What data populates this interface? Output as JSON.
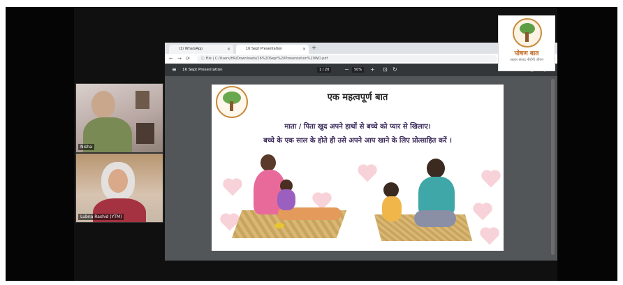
{
  "browser": {
    "tabs": [
      {
        "label": "(1) WhatsApp",
        "close": "×"
      },
      {
        "label": "16 Sept Presentation",
        "close": "×"
      }
    ],
    "new_tab": "+",
    "nav": {
      "back": "←",
      "forward": "→",
      "reload": "⟳"
    },
    "url": "ⓘ File | C:/Users/HR/Downloads/16%20Sept%20Presentation%20WO.pdf"
  },
  "pdf_viewer": {
    "menu": "≡",
    "title": "16 Sept Presentation",
    "pages": "1 / 20",
    "zoom": "50%",
    "minus": "−",
    "plus": "+",
    "fit": "⊡",
    "rotate": "↻",
    "download": "⬇",
    "print": "🖶",
    "more": "⋮"
  },
  "slide": {
    "title": "एक महत्वपूर्ण बात",
    "line1": "माता / पिता खुद अपने हाथों से बच्चे को प्यार से खिलाए।",
    "line2": "बच्चे के एक साल के होते ही उसे अपने आप खाने के लिए प्रोत्साहित करें ।"
  },
  "participants": [
    {
      "name": "Nisha"
    },
    {
      "name": "Lubna Rashid (YTM)"
    }
  ],
  "brand": {
    "name": "पोषण बात",
    "tagline": "आहार संवाद नीरोगी जीवन"
  }
}
